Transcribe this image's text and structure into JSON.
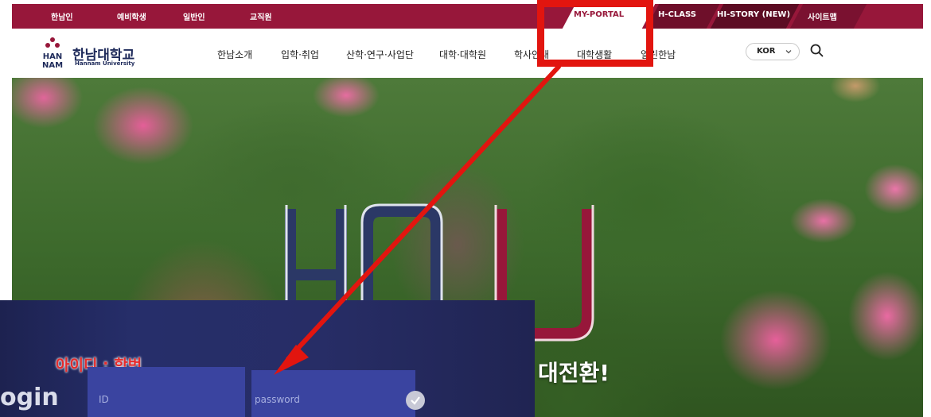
{
  "topbar": {
    "links": [
      "한남인",
      "예비학생",
      "일반인",
      "교직원"
    ],
    "portal": "MY-PORTAL",
    "hclass": "H-CLASS",
    "histtory": "HI-STORY (NEW)",
    "sitemap": "사이트맵"
  },
  "header": {
    "logo_title": "한남대학교",
    "logo_sub": "Hannam University",
    "logo_mark_text": [
      "HAN",
      "NAM"
    ],
    "nav": [
      "한남소개",
      "입학·취업",
      "산학·연구·사업단",
      "대학·대학원",
      "학사안내",
      "대학생활",
      "열린한남"
    ],
    "language": "KOR"
  },
  "hero": {
    "logo_letters": "HNU",
    "tagline_fragment": "대전환!"
  },
  "inset": {
    "hint_label": "아이디 : 학번",
    "login_word": "ogin",
    "id_placeholder": "ID",
    "password_placeholder": "password"
  },
  "colors": {
    "brand": "#97173a",
    "annotation": "#e2150f",
    "navy": "#1e2a5a"
  }
}
